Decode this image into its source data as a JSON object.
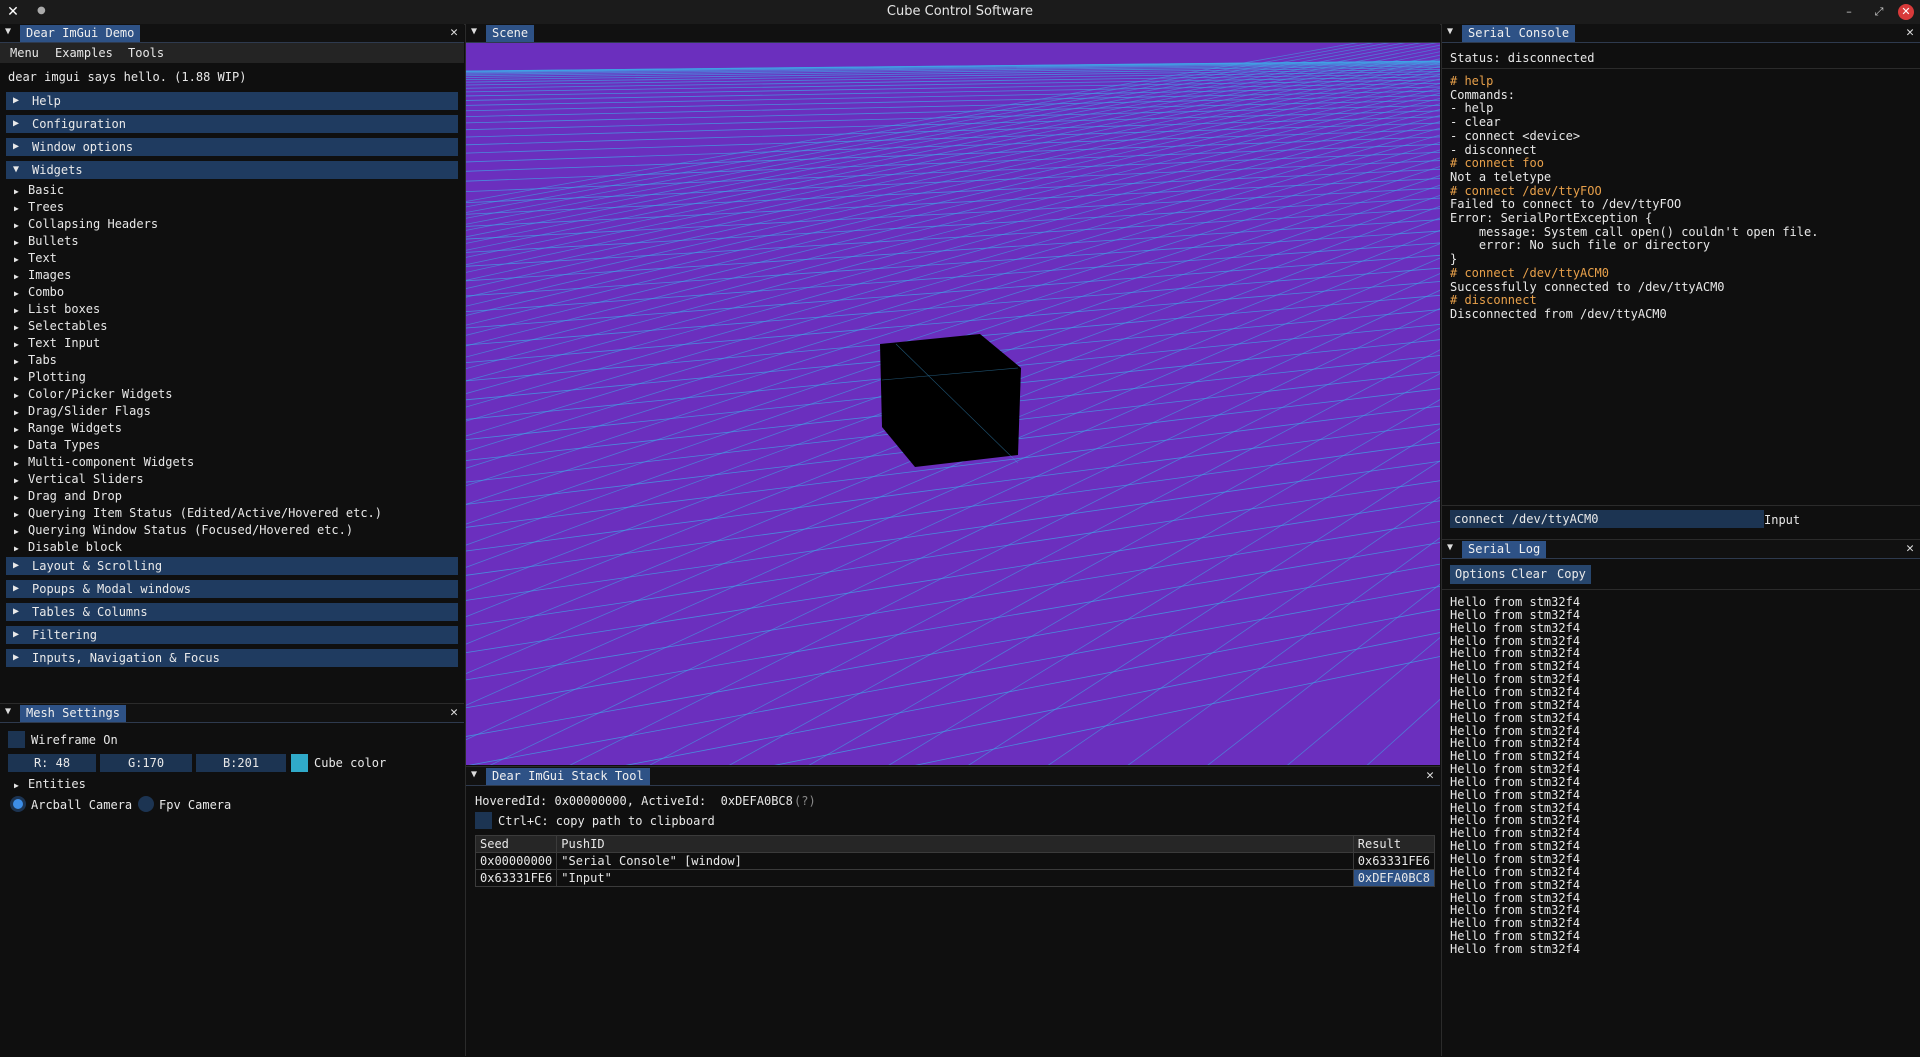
{
  "app": {
    "title": "Cube Control Software"
  },
  "demo_window": {
    "title": "Dear ImGui Demo",
    "menu": [
      "Menu",
      "Examples",
      "Tools"
    ],
    "hello": "dear imgui says hello. (1.88 WIP)",
    "sections_top": [
      "Help",
      "Configuration",
      "Window options"
    ],
    "widgets_section": "Widgets",
    "widget_items": [
      "Basic",
      "Trees",
      "Collapsing Headers",
      "Bullets",
      "Text",
      "Images",
      "Combo",
      "List boxes",
      "Selectables",
      "Text Input",
      "Tabs",
      "Plotting",
      "Color/Picker Widgets",
      "Drag/Slider Flags",
      "Range Widgets",
      "Data Types",
      "Multi-component Widgets",
      "Vertical Sliders",
      "Drag and Drop",
      "Querying Item Status (Edited/Active/Hovered etc.)",
      "Querying Window Status (Focused/Hovered etc.)",
      "Disable block"
    ],
    "sections_bottom": [
      "Layout & Scrolling",
      "Popups & Modal windows",
      "Tables & Columns",
      "Filtering",
      "Inputs, Navigation & Focus"
    ]
  },
  "mesh_settings": {
    "title": "Mesh Settings",
    "wireframe_label": "Wireframe On",
    "r": "R: 48",
    "g": "G:170",
    "b": "B:201",
    "cube_color_label": "Cube color",
    "cube_color": "#30aac9",
    "entities_label": "Entities",
    "camera_arcball": "Arcball Camera",
    "camera_fpv": "Fpv Camera",
    "camera_selected": "Arcball Camera"
  },
  "scene": {
    "title": "Scene",
    "background": "#6b2fbe",
    "grid_color": "#3fa7e6"
  },
  "stack_tool": {
    "title": "Dear ImGui Stack Tool",
    "ids_line": "HoveredId: 0x00000000, ActiveId:  0xDEFA0BC8",
    "help_marker": "(?)",
    "copy_label": "Ctrl+C: copy path to clipboard",
    "columns": [
      "Seed",
      "PushID",
      "Result"
    ],
    "rows": [
      [
        "0x00000000",
        "\"Serial Console\" [window]",
        "0x63331FE6"
      ],
      [
        "0x63331FE6",
        "\"Input\"",
        "0xDEFA0BC8"
      ]
    ]
  },
  "serial_console": {
    "title": "Serial Console",
    "status": "Status: disconnected",
    "lines": [
      {
        "text": "# help",
        "cmd": true
      },
      {
        "text": "Commands:",
        "cmd": false
      },
      {
        "text": "- help",
        "cmd": false
      },
      {
        "text": "- clear",
        "cmd": false
      },
      {
        "text": "- connect <device>",
        "cmd": false
      },
      {
        "text": "- disconnect",
        "cmd": false
      },
      {
        "text": "# connect foo",
        "cmd": true
      },
      {
        "text": "Not a teletype",
        "cmd": false
      },
      {
        "text": "# connect /dev/ttyFOO",
        "cmd": true
      },
      {
        "text": "Failed to connect to /dev/ttyFOO",
        "cmd": false
      },
      {
        "text": "Error: SerialPortException {",
        "cmd": false
      },
      {
        "text": "    message: System call open() couldn't open file.",
        "cmd": false
      },
      {
        "text": "    error: No such file or directory",
        "cmd": false
      },
      {
        "text": "}",
        "cmd": false
      },
      {
        "text": "# connect /dev/ttyACM0",
        "cmd": true
      },
      {
        "text": "Successfully connected to /dev/ttyACM0",
        "cmd": false
      },
      {
        "text": "# disconnect",
        "cmd": true
      },
      {
        "text": "Disconnected from /dev/ttyACM0",
        "cmd": false
      }
    ],
    "input_value": "connect /dev/ttyACM0",
    "input_label": "Input",
    "command_color": "#e8a04a"
  },
  "serial_log": {
    "title": "Serial Log",
    "buttons": [
      "Options",
      "Clear",
      "Copy"
    ],
    "line_text": "Hello from stm32f4",
    "line_count": 28
  }
}
